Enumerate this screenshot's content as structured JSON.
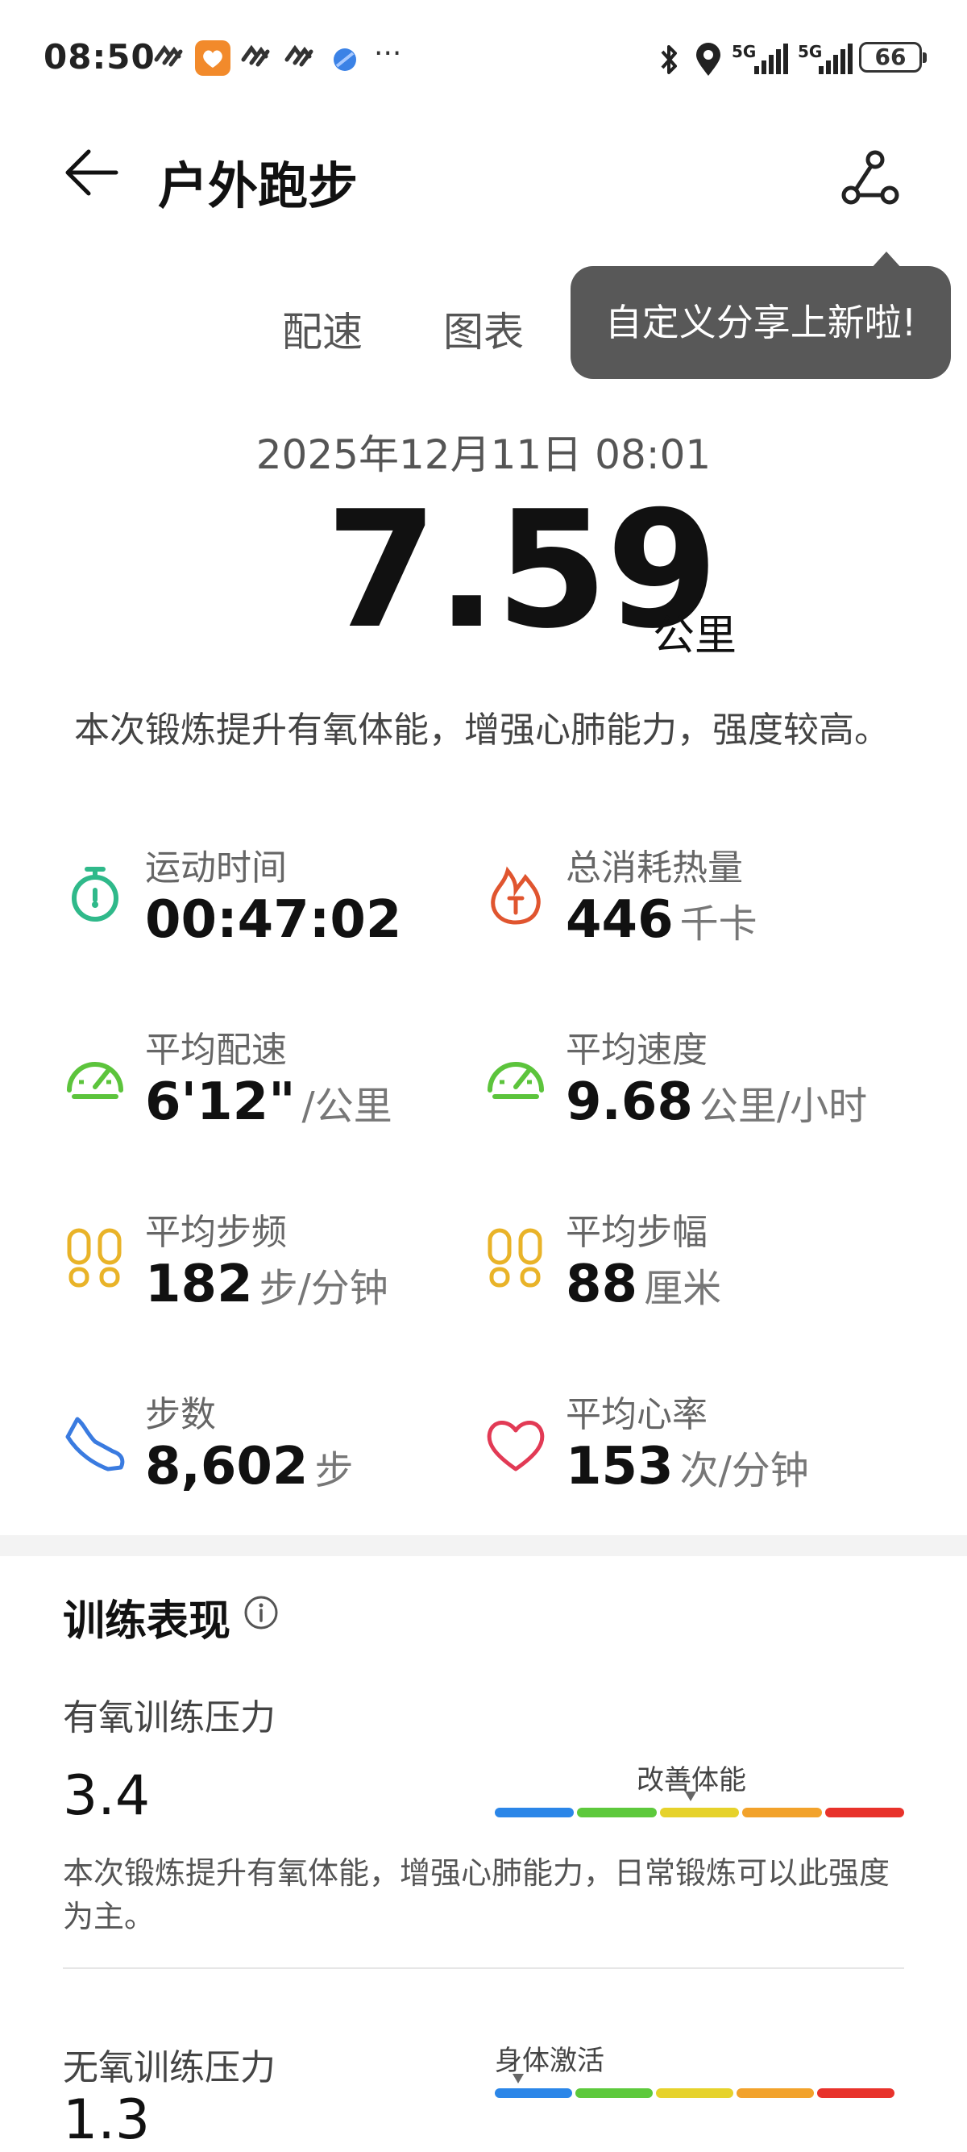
{
  "status_bar": {
    "time": "08:50",
    "battery": "66",
    "net1": "5G",
    "net2": "5G"
  },
  "header": {
    "title": "户外跑步"
  },
  "tabs": [
    "配速",
    "图表"
  ],
  "tooltip": "自定义分享上新啦!",
  "summary": {
    "datetime": "2025年12月11日 08:01",
    "distance": "7.59",
    "distance_unit": "公里",
    "description": "本次锻炼提升有氧体能，增强心肺能力，强度较高。"
  },
  "stats": [
    {
      "label": "运动时间",
      "value": "00:47:02",
      "unit": "",
      "icon": "stopwatch-icon",
      "color": "#2fb98a"
    },
    {
      "label": "总消耗热量",
      "value": "446",
      "unit": "千卡",
      "icon": "calorie-flame-icon",
      "color": "#e0552f"
    },
    {
      "label": "平均配速",
      "value": "6'12\"",
      "unit": "/公里",
      "icon": "pace-gauge-icon",
      "color": "#5cc43c"
    },
    {
      "label": "平均速度",
      "value": "9.68",
      "unit": "公里/小时",
      "icon": "speed-gauge-icon",
      "color": "#5cc43c"
    },
    {
      "label": "平均步频",
      "value": "182",
      "unit": "步/分钟",
      "icon": "footprints-icon",
      "color": "#e9b328"
    },
    {
      "label": "平均步幅",
      "value": "88",
      "unit": "厘米",
      "icon": "footprints-icon",
      "color": "#e9b328"
    },
    {
      "label": "步数",
      "value": "8,602",
      "unit": "步",
      "icon": "shoe-icon",
      "color": "#3a7be0"
    },
    {
      "label": "平均心率",
      "value": "153",
      "unit": "次/分钟",
      "icon": "heart-icon",
      "color": "#e23a55"
    }
  ],
  "training": {
    "title": "训练表现",
    "aerobic": {
      "label": "有氧训练压力",
      "value": "3.4",
      "level": "改善体能",
      "description": "本次锻炼提升有氧体能，增强心肺能力，日常锻炼可以此强度为主。"
    },
    "anaerobic": {
      "label": "无氧训练压力",
      "value": "1.3",
      "level": "身体激活"
    },
    "scale_colors": [
      "#2b86e8",
      "#5dc93c",
      "#e6d22b",
      "#f2a22b",
      "#e8322b"
    ]
  }
}
